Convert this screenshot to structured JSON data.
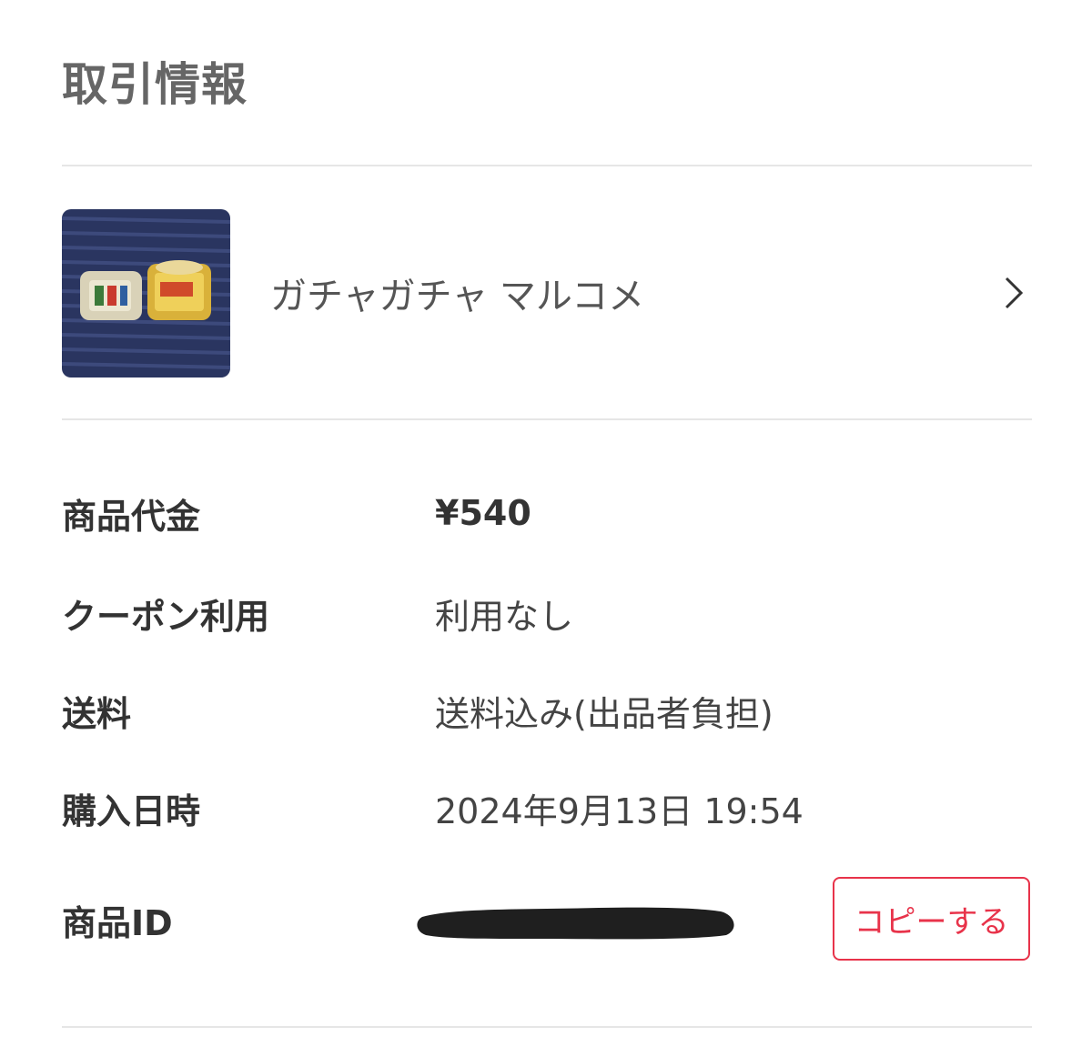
{
  "section": {
    "title": "取引情報"
  },
  "product": {
    "name": "ガチャガチャ マルコメ",
    "thumbnail_icon": "product-thumbnail",
    "chevron_icon": "chevron-right-icon"
  },
  "details": {
    "price": {
      "label": "商品代金",
      "value": "¥540"
    },
    "coupon": {
      "label": "クーポン利用",
      "value": "利用なし"
    },
    "shipping": {
      "label": "送料",
      "value": "送料込み(出品者負担)"
    },
    "purchase_date": {
      "label": "購入日時",
      "value": "2024年9月13日 19:54"
    },
    "item_id": {
      "label": "商品ID",
      "copy_label": "コピーする"
    }
  },
  "colors": {
    "accent": "#e8334a",
    "divider": "#e6e6e6",
    "title": "#666666"
  }
}
